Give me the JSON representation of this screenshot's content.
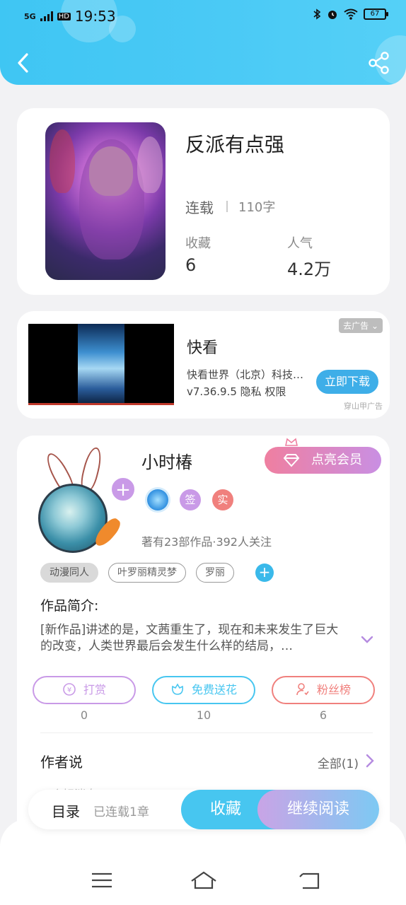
{
  "status_bar": {
    "network": "5G",
    "hd": "HD",
    "time": "19:53",
    "battery": "67"
  },
  "book": {
    "title": "反派有点强",
    "status": "连载",
    "words": "110字",
    "stats": [
      {
        "label": "收藏",
        "value": "6"
      },
      {
        "label": "人气",
        "value": "4.2万"
      }
    ]
  },
  "ad": {
    "remove_label": "去广告",
    "app_name": "快看",
    "company": "快看世界（北京）科技有限公司",
    "meta": "v7.36.9.5  隐私  权限",
    "download_label": "立即下载",
    "source": "穿山甲广告"
  },
  "author": {
    "name": "小时椿",
    "vip_label": "点亮会员",
    "badges": [
      {
        "name": "level-badge",
        "text": "",
        "color": "#3aa3e6"
      },
      {
        "name": "sign-badge",
        "text": "签",
        "color": "#c99ae7"
      },
      {
        "name": "verified-badge",
        "text": "实",
        "color": "#f0807d"
      }
    ],
    "meta": "著有23部作品·392人关注",
    "tags": [
      "动漫同人",
      "叶罗丽精灵梦",
      "罗丽"
    ],
    "intro_title": "作品简介:",
    "intro_text": "[新作品]讲述的是，文茜重生了，现在和未来发生了巨大的改变，人类世界最后会发生什么样的结局，…",
    "actions": [
      {
        "label": "打赏",
        "count": "0",
        "color": "#c99ae7"
      },
      {
        "label": "免费送花",
        "count": "10",
        "color": "#47c6f0"
      },
      {
        "label": "粉丝榜",
        "count": "6",
        "color": "#f0807d"
      }
    ],
    "says_title": "作者说",
    "says_all": "全部(1)",
    "says_preview": "一个好消息"
  },
  "bottom_bar": {
    "catalog": "目录",
    "updated": "已连载1章",
    "collect": "收藏",
    "read": "继续阅读"
  },
  "colors": {
    "header": "#47c6f0",
    "accent_purple": "#c99ae7",
    "accent_pink": "#f0807d"
  }
}
